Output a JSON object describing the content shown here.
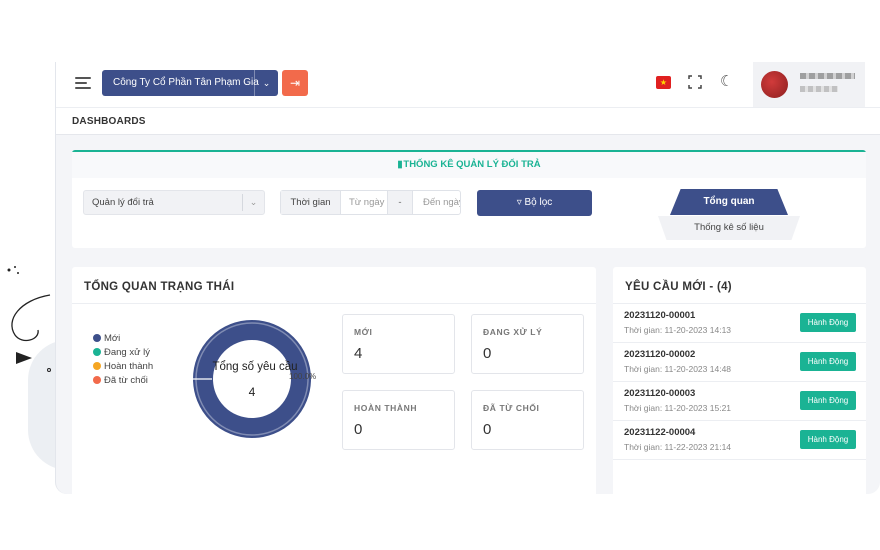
{
  "header": {
    "company_name": "Công Ty Cổ Phần Tân Phạm Gia"
  },
  "page": {
    "title": "DASHBOARDS"
  },
  "filter": {
    "title": "THỐNG KÊ QUẢN LÝ ĐỔI TRẢ",
    "select_value": "Quản lý đổi trả",
    "time_label": "Thời gian",
    "from_placeholder": "Từ ngày",
    "separator": "-",
    "to_placeholder": "Đến ngày",
    "filter_button": "Bộ lọc",
    "tabs": [
      "Tổng quan",
      "Thống kê số liệu"
    ]
  },
  "status_overview": {
    "title": "TỔNG QUAN TRẠNG THÁI",
    "legend": [
      {
        "label": "Mới",
        "color": "#3d4f8a"
      },
      {
        "label": "Đang xử lý",
        "color": "#1ab394"
      },
      {
        "label": "Hoàn thành",
        "color": "#f5a623"
      },
      {
        "label": "Đã từ chối",
        "color": "#f26a4b"
      }
    ],
    "donut_label": "Tổng số yêu cầu",
    "donut_value": "4",
    "donut_percent": "100.0%",
    "donut_fraction": 1.0,
    "donut_color": "#3d4f8a",
    "stats": [
      {
        "label": "MỚI",
        "value": "4"
      },
      {
        "label": "ĐANG XỬ LÝ",
        "value": "0"
      },
      {
        "label": "HOÀN THÀNH",
        "value": "0"
      },
      {
        "label": "ĐÃ TỪ CHỐI",
        "value": "0"
      }
    ]
  },
  "requests": {
    "title": "YÊU CẦU MỚI - (4)",
    "action_label": "Hành Động",
    "items": [
      {
        "code": "20231120-00001",
        "time": "Thời gian: 11-20-2023 14:13"
      },
      {
        "code": "20231120-00002",
        "time": "Thời gian: 11-20-2023 14:48"
      },
      {
        "code": "20231120-00003",
        "time": "Thời gian: 11-20-2023 15:21"
      },
      {
        "code": "20231122-00004",
        "time": "Thời gian: 11-22-2023 21:14"
      }
    ]
  },
  "icons": {
    "menu": "menu-icon",
    "logout": "logout-icon",
    "language": "vietnam-flag-icon",
    "fullscreen": "fullscreen-icon",
    "theme": "moon-icon",
    "chart": "bar-chart-icon",
    "filter": "funnel-icon"
  },
  "colors": {
    "primary": "#3d4f8a",
    "accent": "#1ab394",
    "danger": "#f26a4b"
  }
}
